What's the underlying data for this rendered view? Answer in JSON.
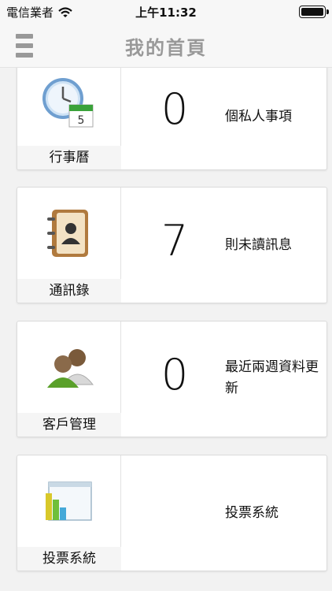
{
  "status_bar": {
    "carrier": "電信業者",
    "time": "上午11:32"
  },
  "nav": {
    "title": "我的首頁"
  },
  "cards": [
    {
      "label": "行事曆",
      "count": "0",
      "desc": "個私人事項",
      "icon": "calendar-clock-icon"
    },
    {
      "label": "通訊錄",
      "count": "7",
      "desc": "則未讀訊息",
      "icon": "address-book-icon"
    },
    {
      "label": "客戶管理",
      "count": "0",
      "desc": "最近兩週資料更新",
      "icon": "customers-icon"
    },
    {
      "label": "投票系統",
      "count": "",
      "desc": "投票系統",
      "icon": "bar-chart-icon"
    }
  ]
}
